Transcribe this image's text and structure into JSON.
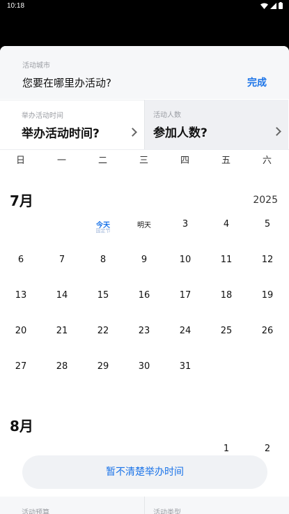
{
  "status_bar": {
    "time": "10:18",
    "icons": [
      "wifi-icon",
      "signal-icon",
      "battery-icon"
    ]
  },
  "city": {
    "label": "活动城市",
    "question": "您要在哪里办活动?",
    "done_label": "完成"
  },
  "time_selector": {
    "label": "举办活动时间",
    "value": "举办活动时间?"
  },
  "people_selector": {
    "label": "活动人数",
    "value": "参加人数?"
  },
  "weekdays": [
    "日",
    "一",
    "二",
    "三",
    "四",
    "五",
    "六"
  ],
  "july": {
    "title": "7月",
    "year": "2025",
    "rows": [
      [
        null,
        null,
        {
          "text": "今天",
          "sub": "国定节",
          "type": "today"
        },
        {
          "text": "明天",
          "type": "tomorrow"
        },
        {
          "text": "3"
        },
        {
          "text": "4"
        },
        {
          "text": "5"
        }
      ],
      [
        {
          "text": "6"
        },
        {
          "text": "7"
        },
        {
          "text": "8"
        },
        {
          "text": "9"
        },
        {
          "text": "10"
        },
        {
          "text": "11"
        },
        {
          "text": "12"
        }
      ],
      [
        {
          "text": "13"
        },
        {
          "text": "14"
        },
        {
          "text": "15"
        },
        {
          "text": "16"
        },
        {
          "text": "17"
        },
        {
          "text": "18"
        },
        {
          "text": "19"
        }
      ],
      [
        {
          "text": "20"
        },
        {
          "text": "21"
        },
        {
          "text": "22"
        },
        {
          "text": "23"
        },
        {
          "text": "24"
        },
        {
          "text": "25"
        },
        {
          "text": "26"
        }
      ],
      [
        {
          "text": "27"
        },
        {
          "text": "28"
        },
        {
          "text": "29"
        },
        {
          "text": "30"
        },
        {
          "text": "31"
        },
        null,
        null
      ]
    ]
  },
  "august": {
    "title": "8月",
    "rows": [
      [
        null,
        null,
        null,
        null,
        null,
        {
          "text": "1"
        },
        {
          "text": "2"
        }
      ]
    ]
  },
  "unknown_time_button": "暂不清楚举办时间",
  "bottom_row": {
    "budget_label": "活动预算",
    "type_label": "活动类型"
  },
  "colors": {
    "accent": "#1a73e8",
    "status_bar": "#000000"
  }
}
